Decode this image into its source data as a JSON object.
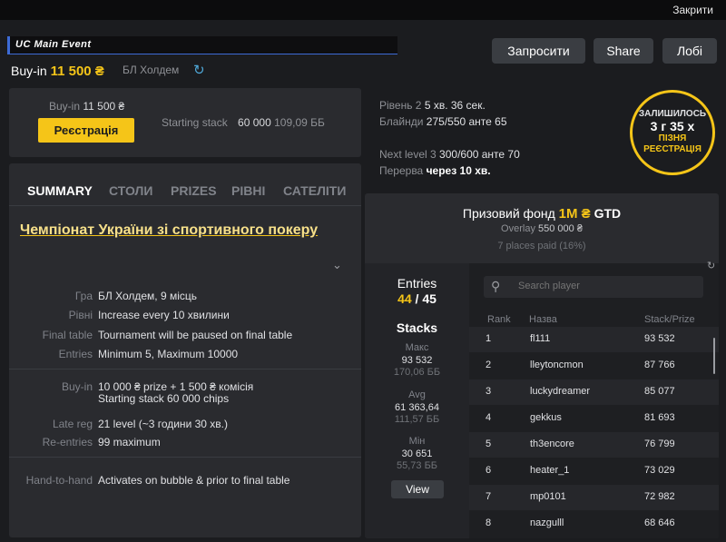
{
  "topbar": {
    "close_label": "Закрити"
  },
  "header": {
    "title": "UC Main Event",
    "buyin_label": "Buy-in",
    "buyin_value": "11 500 ₴",
    "game": "БЛ Холдем",
    "buttons": {
      "invite": "Запросити",
      "share": "Share",
      "lobby": "Лобі"
    }
  },
  "registration": {
    "buyin_label": "Buy-in",
    "buyin_value": "11 500 ₴",
    "register_button": "Реєстрація",
    "starting_stack_label": "Starting stack",
    "starting_stack_value": "60 000",
    "starting_stack_bb": "109,09 ББ"
  },
  "tabs": [
    "SUMMARY",
    "СТОЛИ",
    "PRIZES",
    "РІВНІ",
    "САТЕЛІТИ"
  ],
  "summary": {
    "title": "Чемпіонат України зі спортивного покеру",
    "rows_a": [
      {
        "label": "Гра",
        "value": "БЛ Холдем, 9 місць"
      },
      {
        "label": "Рівні",
        "value": "Increase every 10 хвилини"
      },
      {
        "label": "Final table",
        "value": "Tournament will be paused on final table"
      },
      {
        "label": "Entries",
        "value": "Minimum 5, Maximum 10000"
      }
    ],
    "buyin_label": "Buy-in",
    "buyin_line1": "10 000 ₴ prize + 1 500 ₴ комісія",
    "buyin_line2": "Starting stack 60 000 chips",
    "late_reg_label": "Late reg",
    "late_reg_value": "21 level (~3 години 30 хв.)",
    "reentries_label": "Re-entries",
    "reentries_value": "99 maximum",
    "h2h_label": "Hand-to-hand",
    "h2h_value": "Activates on bubble & prior to final table"
  },
  "level": {
    "level_label": "Рівень 2",
    "level_time": "5 хв. 36 сек.",
    "blinds_label": "Блайнди",
    "blinds_value": "275/550 анте 65",
    "next_label": "Next level 3",
    "next_value": "300/600 анте 70",
    "break_label": "Перерва",
    "break_value": "через 10 хв."
  },
  "late_badge": {
    "line1": "ЗАЛИШИЛОСЬ",
    "line2": "3 г 35 х",
    "line3": "ПІЗНЯ",
    "line4": "РЕЄСТРАЦІЯ"
  },
  "prize": {
    "title": "Призовий фонд",
    "amount": "1M ₴",
    "gtd": "GTD",
    "overlay_label": "Overlay",
    "overlay_value": "550 000 ₴",
    "paid": "7 places paid (16%)"
  },
  "stats": {
    "entries_label": "Entries",
    "entries_current": "44",
    "entries_sep": "/",
    "entries_total": "45",
    "stacks_label": "Stacks",
    "max_label": "Макс",
    "max_value": "93 532",
    "max_bb": "170,06 ББ",
    "avg_label": "Avg",
    "avg_value": "61 363,64",
    "avg_bb": "111,57 ББ",
    "min_label": "Мін",
    "min_value": "30 651",
    "min_bb": "55,73 ББ",
    "view_button": "View"
  },
  "players": {
    "search_placeholder": "Search player",
    "headers": {
      "rank": "Rank",
      "name": "Назва",
      "stack": "Stack/Prize"
    },
    "rows": [
      {
        "rank": "1",
        "name": "fl111",
        "stack": "93 532"
      },
      {
        "rank": "2",
        "name": "lleytoncmon",
        "stack": "87 766"
      },
      {
        "rank": "3",
        "name": "luckydreamer",
        "stack": "85 077"
      },
      {
        "rank": "4",
        "name": "gekkus",
        "stack": "81 693"
      },
      {
        "rank": "5",
        "name": "th3encore",
        "stack": "76 799"
      },
      {
        "rank": "6",
        "name": "heater_1",
        "stack": "73 029"
      },
      {
        "rank": "7",
        "name": "mp0101",
        "stack": "72 982"
      },
      {
        "rank": "8",
        "name": "nazgulll",
        "stack": "68 646"
      }
    ]
  }
}
